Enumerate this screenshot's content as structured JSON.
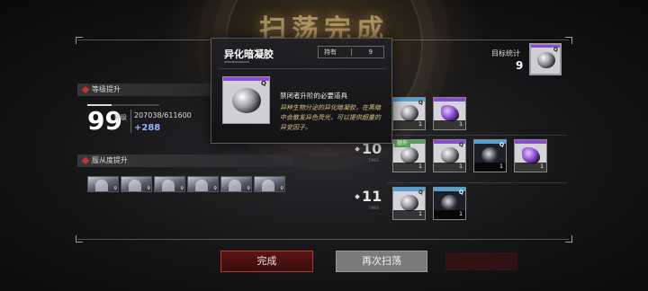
{
  "header": {
    "title": "扫荡完成"
  },
  "level_section": {
    "heading": "等级提升",
    "level": "99",
    "level_label": "等级",
    "exp": "207038/611600",
    "exp_gain": "+288",
    "progress": 0.34
  },
  "favor_section": {
    "heading": "服从度提升",
    "portraits": [
      {
        "marker": "♀"
      },
      {
        "marker": "♀"
      },
      {
        "marker": "♀"
      },
      {
        "marker": "♀"
      },
      {
        "marker": "♀"
      },
      {
        "marker": "♀"
      }
    ]
  },
  "target": {
    "label": "目标统计",
    "count": "9",
    "quality": "Q",
    "rarity_color": "#8a4ad1"
  },
  "rounds": [
    {
      "number": "",
      "sublabel": "",
      "items": [
        {
          "count": "1",
          "icon": "silver-gel-icon",
          "rarity": "#4fa3d8",
          "quality": "Q"
        },
        {
          "count": "1",
          "icon": "purple-crystal-icon",
          "rarity": "#8a4ad1",
          "quality": ""
        }
      ]
    },
    {
      "number": "10",
      "sublabel": "TIMES",
      "items": [
        {
          "count": "1",
          "icon": "silver-gel-icon",
          "rarity": "#5aa05a",
          "quality": "",
          "badge": "额外"
        },
        {
          "count": "1",
          "icon": "silver-gel-icon",
          "rarity": "#8a4ad1",
          "quality": "Q"
        },
        {
          "count": "1",
          "icon": "dark-gel-icon",
          "rarity": "#4fa3d8",
          "quality": "Q"
        },
        {
          "count": "1",
          "icon": "purple-orb-icon",
          "rarity": "#8a4ad1",
          "quality": ""
        }
      ]
    },
    {
      "number": "11",
      "sublabel": "TIMES",
      "items": [
        {
          "count": "1",
          "icon": "silver-gel-icon",
          "rarity": "#4fa3d8",
          "quality": "Q"
        },
        {
          "count": "1",
          "icon": "dark-gel-icon",
          "rarity": "#4fa3d8",
          "quality": "Q"
        }
      ]
    }
  ],
  "popup": {
    "title": "异化暗凝胶",
    "own_label": "持有",
    "own_value": "9",
    "quality": "Q",
    "rarity_color": "#8a4ad1",
    "desc_title": "禁闭者升阶的必要道具",
    "desc": "异种生物分泌的异化暗凝胶，在黑暗中会散发异色荧光，可以提供超量的异变因子。"
  },
  "buttons": {
    "done": "完成",
    "again": "再次扫荡"
  },
  "colors": {
    "accent_red": "#c8322e",
    "exp_gain": "#8fb6ff",
    "desc_gold": "#d8c28a"
  }
}
